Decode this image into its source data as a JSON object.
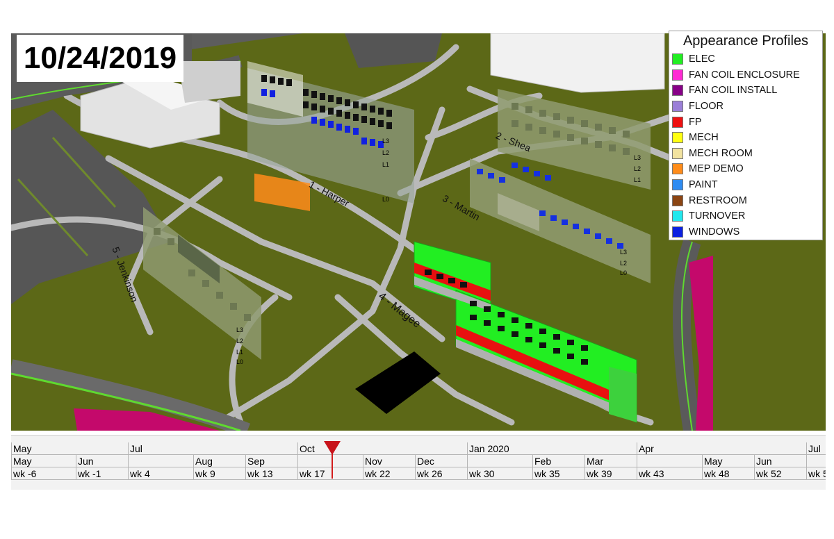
{
  "current_date": "10/24/2019",
  "legend": {
    "title": "Appearance Profiles",
    "items": [
      {
        "label": "ELEC",
        "color": "#22ee22"
      },
      {
        "label": "FAN COIL ENCLOSURE",
        "color": "#ff2ad4"
      },
      {
        "label": "FAN COIL INSTALL",
        "color": "#880088"
      },
      {
        "label": "FLOOR",
        "color": "#9b7fd8"
      },
      {
        "label": "FP",
        "color": "#ee1111"
      },
      {
        "label": "MECH",
        "color": "#ffff11"
      },
      {
        "label": "MECH ROOM",
        "color": "#f2e3a0"
      },
      {
        "label": "MEP DEMO",
        "color": "#ff8c1a"
      },
      {
        "label": "PAINT",
        "color": "#2e8cf2"
      },
      {
        "label": "RESTROOM",
        "color": "#8b4513"
      },
      {
        "label": "TURNOVER",
        "color": "#22e8ee"
      },
      {
        "label": "WINDOWS",
        "color": "#0b20e0"
      }
    ]
  },
  "buildings": [
    {
      "id": "harper",
      "label": "1 - Harper"
    },
    {
      "id": "shea",
      "label": "2 - Shea"
    },
    {
      "id": "martin",
      "label": "3 - Martin"
    },
    {
      "id": "magee",
      "label": "4 - Magee"
    },
    {
      "id": "jenkinson",
      "label": "5 - Jenkinson"
    }
  ],
  "floor_labels": [
    "L3",
    "L2",
    "L1",
    "L0"
  ],
  "timeline": {
    "months_major": [
      "May",
      "Jul",
      "Oct",
      "Jan 2020",
      "Apr",
      "Jul"
    ],
    "months_minor": [
      "May",
      "Jun",
      "Aug",
      "Sep",
      "Nov",
      "Dec",
      "Feb",
      "Mar",
      "May",
      "Jun"
    ],
    "weeks": [
      "wk -6",
      "wk -1",
      "wk 4",
      "wk 9",
      "wk 13",
      "wk 17",
      "wk 22",
      "wk 26",
      "wk 30",
      "wk 35",
      "wk 39",
      "wk 43",
      "wk 48",
      "wk 52",
      "wk 5"
    ]
  }
}
